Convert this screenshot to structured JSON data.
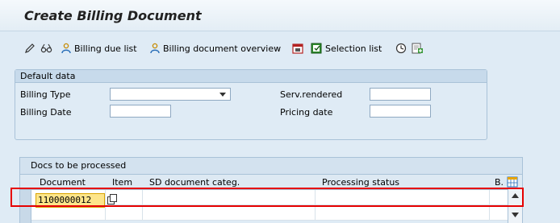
{
  "title": "Create Billing Document",
  "toolbar": {
    "billing_due_list": "Billing due list",
    "billing_doc_overview": "Billing document overview",
    "selection_list": "Selection list"
  },
  "default_data": {
    "header": "Default data",
    "billing_type_label": "Billing Type",
    "billing_date_label": "Billing Date",
    "serv_rendered_label": "Serv.rendered",
    "pricing_date_label": "Pricing date",
    "billing_type_value": "",
    "billing_date_value": "",
    "serv_rendered_value": "",
    "pricing_date_value": ""
  },
  "docs_table": {
    "title": "Docs to be processed",
    "columns": [
      "Document",
      "Item",
      "SD document categ.",
      "Processing status",
      "B."
    ],
    "rows": [
      {
        "document": "1100000012",
        "item": "",
        "sd_categ": "",
        "status": ""
      }
    ]
  },
  "colors": {
    "highlight": "#e60000",
    "input_active": "#fde58a",
    "background": "#dfebf5"
  }
}
